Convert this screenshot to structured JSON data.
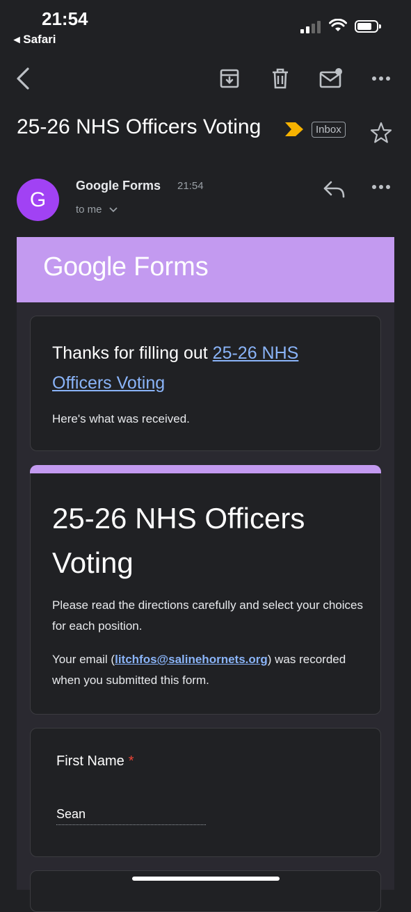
{
  "status_bar": {
    "time": "21:54",
    "back_app": "◂ Safari"
  },
  "toolbar": {
    "icons": [
      "back-arrow-icon",
      "archive-icon",
      "trash-icon",
      "mark-unread-icon",
      "more-icon"
    ]
  },
  "email": {
    "subject": "25-26 NHS Officers Voting",
    "label": "Inbox",
    "sender": {
      "initial": "G",
      "name": "Google Forms",
      "time": "21:54",
      "recipient": "to me"
    }
  },
  "forms_header": {
    "logo_google": "Google",
    "logo_forms": "Forms",
    "color": "#c39af0"
  },
  "thanks": {
    "prefix": "Thanks for filling out ",
    "link": "25-26 NHS Officers Voting",
    "received": "Here's what was received."
  },
  "form": {
    "title": "25-26 NHS Officers Voting",
    "description": "Please read the directions carefully and select your choices for each position.",
    "email_prefix": "Your email (",
    "email": "litchfos@salinehornets.org",
    "email_suffix": ") was recorded when you submitted this form."
  },
  "questions": [
    {
      "label": "First Name",
      "required_mark": "*",
      "answer": "Sean"
    }
  ],
  "colors": {
    "accent": "#c39af0",
    "link": "#8ab4f8",
    "avatar": "#a142f4",
    "background": "#202124"
  }
}
